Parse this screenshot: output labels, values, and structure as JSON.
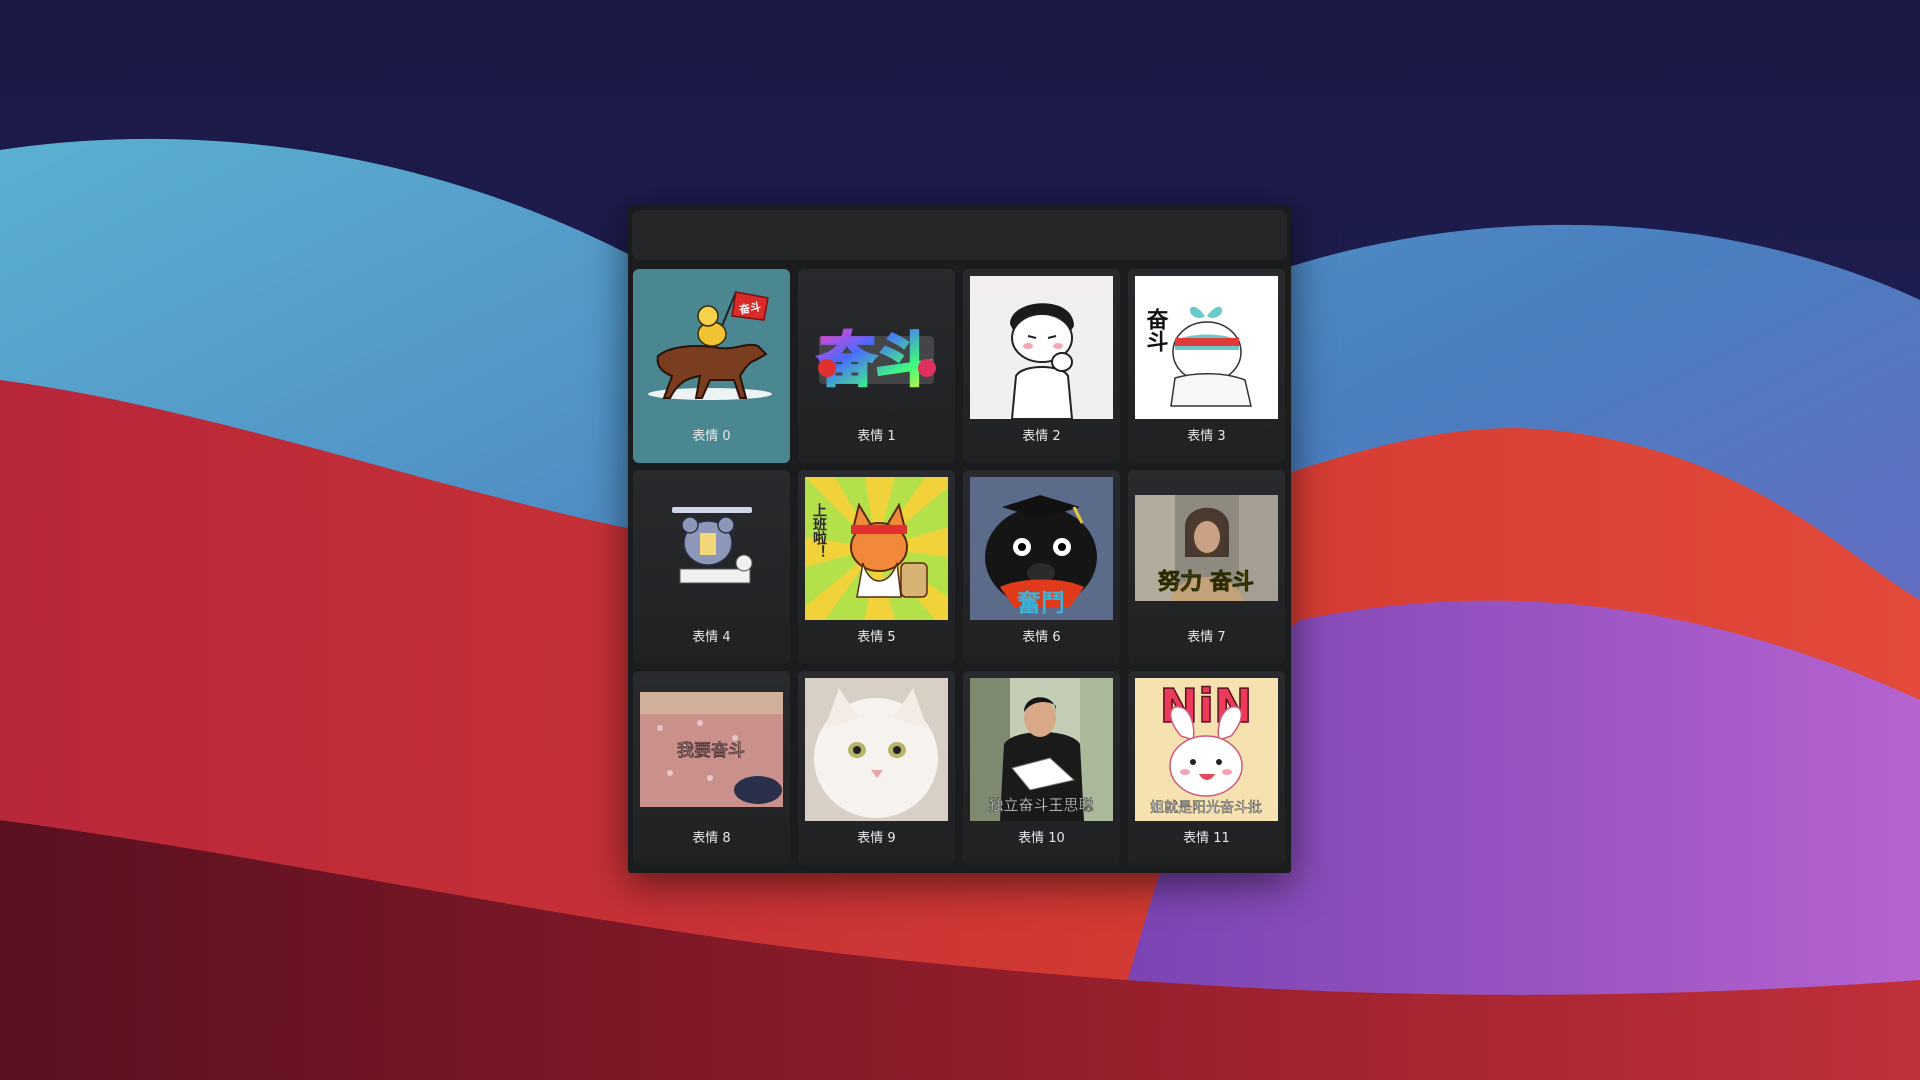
{
  "colors": {
    "selected_tile": "#4a8791",
    "panel_background": "#1b1c1e",
    "tile_background": "#282a2d"
  },
  "search": {
    "value": "",
    "placeholder": ""
  },
  "selected_index": 0,
  "stickers": [
    {
      "label": "表情 0",
      "art_text": "奋斗",
      "icon": "horse-rider-flag-icon"
    },
    {
      "label": "表情 1",
      "art_text": "奋斗",
      "icon": "neon-text-icon"
    },
    {
      "label": "表情 2",
      "art_text": "",
      "icon": "thinking-cartoon-icon"
    },
    {
      "label": "表情 3",
      "art_text": "奋斗",
      "icon": "sprout-character-icon"
    },
    {
      "label": "表情 4",
      "art_text": "",
      "icon": "desk-character-icon"
    },
    {
      "label": "表情 5",
      "art_text": "上班啦！",
      "icon": "fox-backpack-icon"
    },
    {
      "label": "表情 6",
      "art_text": "奮鬥",
      "icon": "honey-badger-icon"
    },
    {
      "label": "表情 7",
      "art_text": "努力 奋斗",
      "icon": "woman-eating-icon"
    },
    {
      "label": "表情 8",
      "art_text": "我要奋斗",
      "icon": "person-in-bed-icon"
    },
    {
      "label": "表情 9",
      "art_text": "",
      "icon": "white-cat-icon"
    },
    {
      "label": "表情 10",
      "art_text": "独立奋斗王思聪",
      "icon": "man-reading-icon"
    },
    {
      "label": "表情 11",
      "art_text": "姐就是阳光奋斗批",
      "icon": "pink-bunny-icon"
    }
  ]
}
